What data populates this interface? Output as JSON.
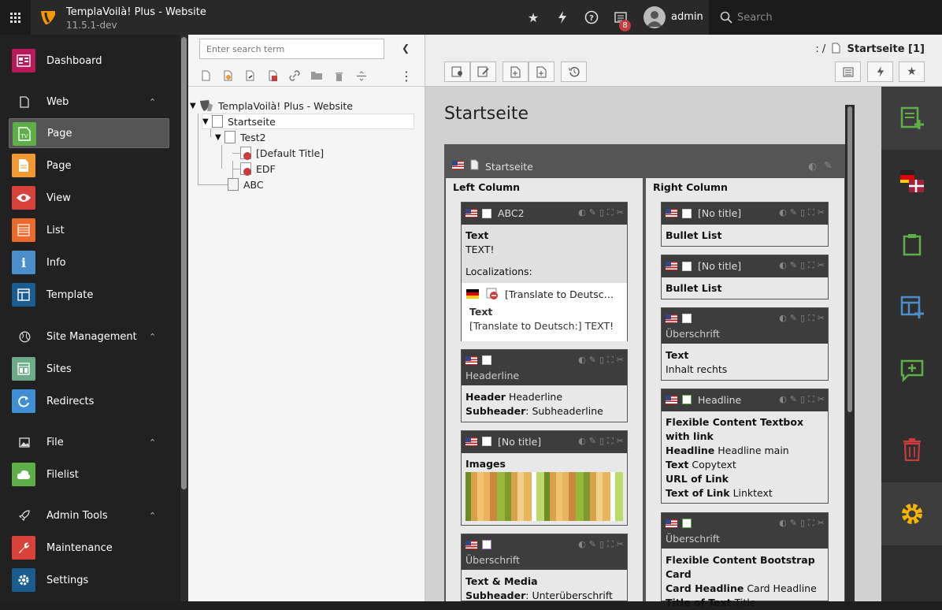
{
  "topbar": {
    "site_name": "TemplaVoilà! Plus - Website",
    "version": "11.5.1-dev",
    "notification_count": "8",
    "username": "admin",
    "search_placeholder": "Search"
  },
  "modules": {
    "dashboard": "Dashboard",
    "web": "Web",
    "page_tv": "Page",
    "page": "Page",
    "view": "View",
    "list": "List",
    "info": "Info",
    "template": "Template",
    "site_management": "Site Management",
    "sites": "Sites",
    "redirects": "Redirects",
    "file": "File",
    "filelist": "Filelist",
    "admin_tools": "Admin Tools",
    "maintenance": "Maintenance",
    "settings": "Settings"
  },
  "tree": {
    "search_placeholder": "Enter search term",
    "root": "TemplaVoilà! Plus - Website",
    "startseite": "Startseite",
    "test2": "Test2",
    "default_title": "[Default Title]",
    "edf": "EDF",
    "abc": "ABC"
  },
  "docheader": {
    "breadcrumb_prefix": ": /",
    "page": "Startseite [1]"
  },
  "content": {
    "page_title": "Startseite",
    "page_box_title": "Startseite",
    "left_column": "Left Column",
    "right_column": "Right Column",
    "left": {
      "abc2": {
        "title": "ABC2",
        "field_label": "Text",
        "field_value": "TEXT!",
        "localizations": "Localizations:",
        "loc_title": "[Translate to Deutsc…",
        "loc_field_label": "Text",
        "loc_field_value": "[Translate to Deutsch:] TEXT!"
      },
      "headerline": {
        "sub": "Headerline",
        "header_label": "Header",
        "header_value": "Headerline",
        "subheader_label": "Subheader",
        "subheader_value": ": Subheaderline"
      },
      "images": {
        "title": "[No title]",
        "field_label": "Images"
      },
      "textmedia": {
        "sub": "Überschrift",
        "field_label": "Text & Media",
        "subheader_label": "Subheader",
        "subheader_value": ": Unterüberschrift"
      }
    },
    "right": {
      "bullet1": {
        "title": "[No title]",
        "field_label": "Bullet List"
      },
      "bullet2": {
        "title": "[No title]",
        "field_label": "Bullet List"
      },
      "text": {
        "sub": "Überschrift",
        "field_label": "Text",
        "field_value": "Inhalt rechts"
      },
      "headline": {
        "title": "Headline",
        "type_line1": "Flexible Content Textbox",
        "type_line2": "with link",
        "headline_label": "Headline",
        "headline_value": "Headline main",
        "text_label": "Text",
        "text_value": "Copytext",
        "url_label": "URL of Link",
        "linktext_label": "Text of Link",
        "linktext_value": "Linktext"
      },
      "card": {
        "sub": "Überschrift",
        "type_line1": "Flexible Content Bootstrap",
        "type_line2": "Card",
        "card_headline_label": "Card Headline",
        "card_headline_value": "Card Headline",
        "title_label": "Title of Text",
        "title_value": "Title"
      }
    }
  },
  "colors": {
    "topbar": "#292929",
    "modmenu": "#212121",
    "accent_green": "#5eaf48",
    "accent_blue": "#4a8fca",
    "accent_red": "#c83c3c",
    "accent_yellow": "#f5b400"
  }
}
